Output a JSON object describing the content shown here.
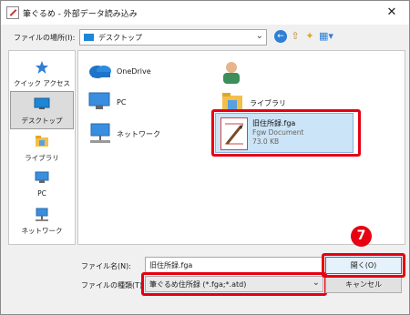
{
  "window": {
    "title": "筆ぐるめ - 外部データ読み込み",
    "close_glyph": "✕"
  },
  "location": {
    "label": "ファイルの場所(I):",
    "value": "デスクトップ"
  },
  "sidebar": {
    "items": [
      {
        "label": "クイック アクセス",
        "icon": "star-icon"
      },
      {
        "label": "デスクトップ",
        "icon": "desktop-icon",
        "selected": true
      },
      {
        "label": "ライブラリ",
        "icon": "library-icon"
      },
      {
        "label": "PC",
        "icon": "pc-icon"
      },
      {
        "label": "ネットワーク",
        "icon": "network-icon"
      }
    ]
  },
  "main": {
    "items": [
      {
        "label": "OneDrive",
        "icon": "cloud-icon"
      },
      {
        "label": "PC",
        "icon": "pc-icon"
      },
      {
        "label": "ネットワーク",
        "icon": "network-icon"
      },
      {
        "label": "",
        "icon": "user-folder-icon"
      },
      {
        "label": "ライブラリ",
        "icon": "library-icon"
      }
    ],
    "file": {
      "name": "旧住所録.fga",
      "type": "Fgw Document",
      "size": "73.0 KB"
    }
  },
  "form": {
    "filename_label": "ファイル名(N):",
    "filename_value": "旧住所録.fga",
    "filetype_label": "ファイルの種類(T):",
    "filetype_value": "筆ぐるめ住所録 (*.fga;*.atd)",
    "open_label": "開く(O)",
    "cancel_label": "キャンセル"
  },
  "annotation": {
    "step_number": "7"
  },
  "colors": {
    "highlight": "#e60012",
    "selection": "#cce4f7",
    "accent": "#1e86d6"
  }
}
